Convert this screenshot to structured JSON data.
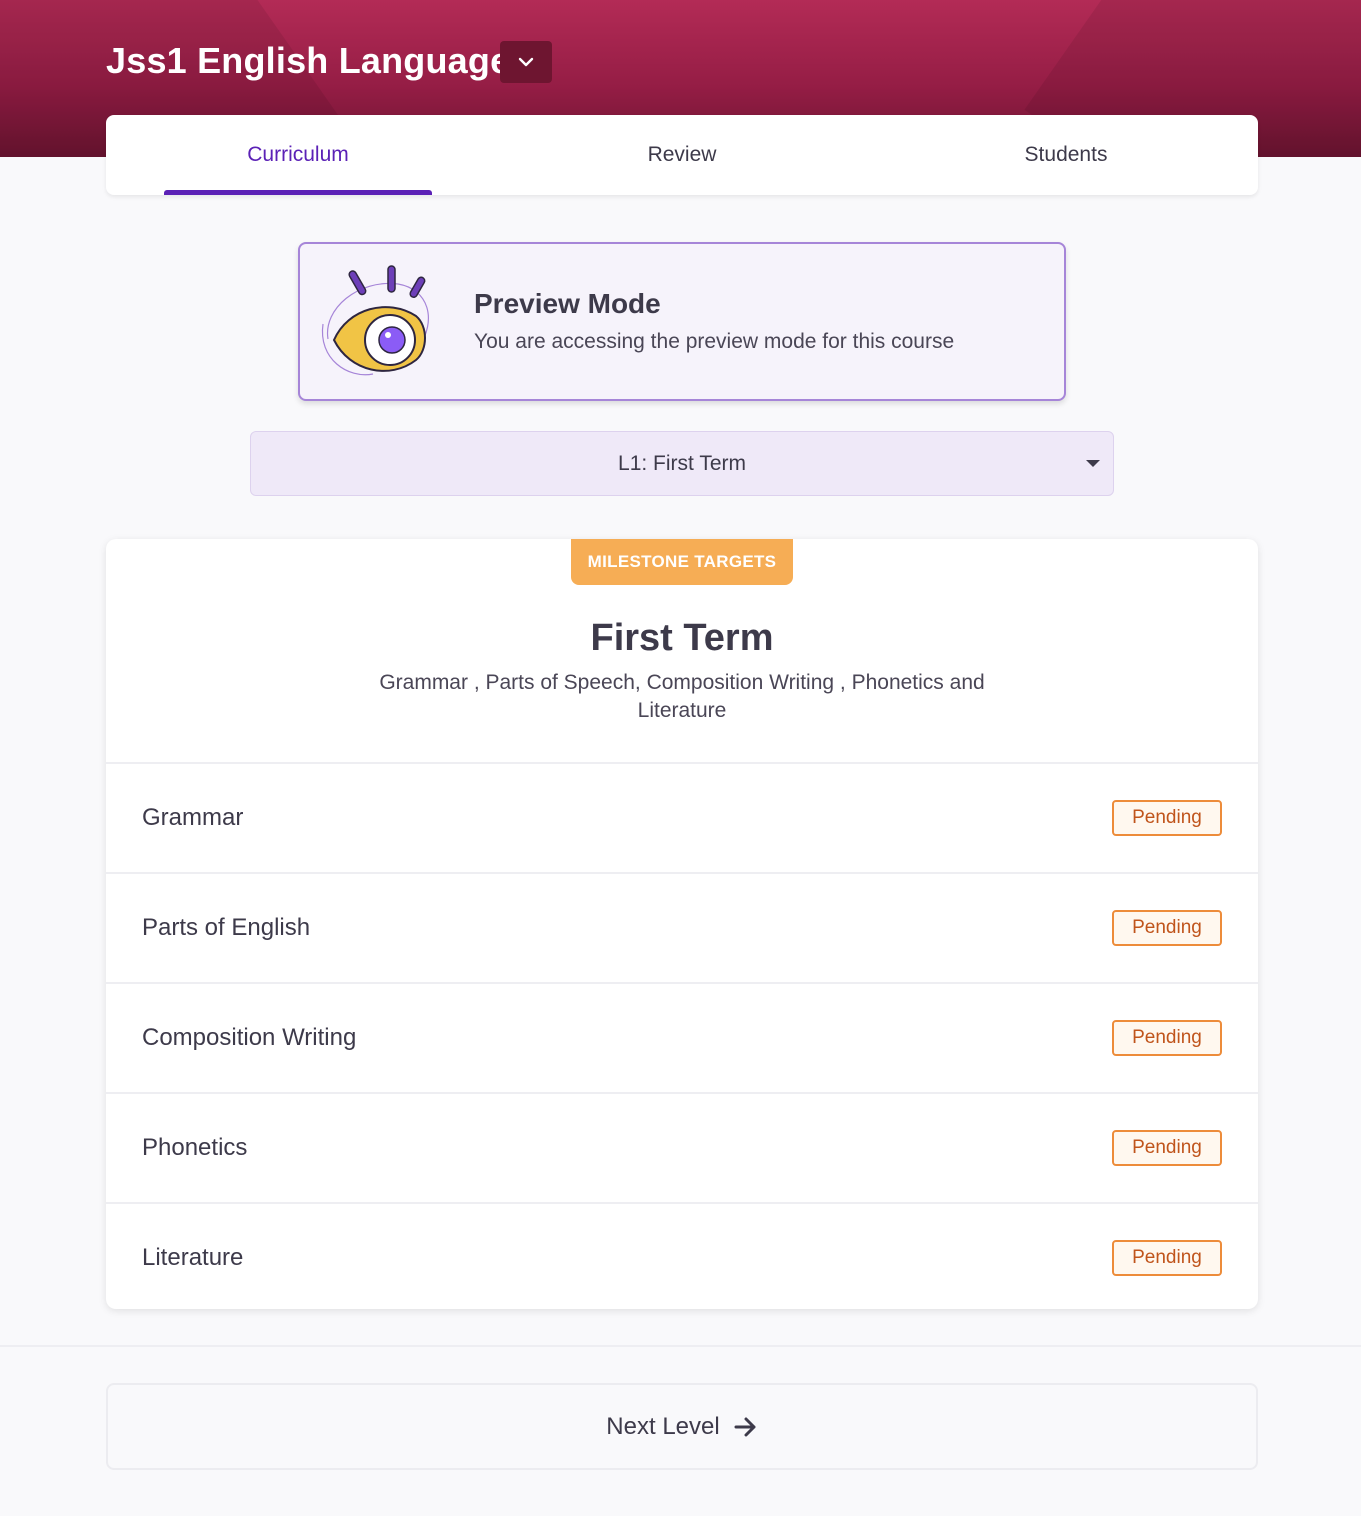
{
  "header": {
    "course_title": "Jss1 English Language"
  },
  "tabs": [
    {
      "label": "Curriculum",
      "active": true
    },
    {
      "label": "Review",
      "active": false
    },
    {
      "label": "Students",
      "active": false
    }
  ],
  "preview": {
    "title": "Preview Mode",
    "text": "You are accessing the preview mode for this course"
  },
  "level_select": {
    "selected": "L1: First Term"
  },
  "milestone": {
    "badge": "MILESTONE TARGETS",
    "title": "First Term",
    "description": "Grammar , Parts of Speech, Composition Writing , Phonetics and Literature",
    "targets": [
      {
        "name": "Grammar",
        "status": "Pending"
      },
      {
        "name": "Parts of English",
        "status": "Pending"
      },
      {
        "name": "Composition Writing",
        "status": "Pending"
      },
      {
        "name": "Phonetics",
        "status": "Pending"
      },
      {
        "name": "Literature",
        "status": "Pending"
      }
    ]
  },
  "footer": {
    "next_label": "Next Level"
  },
  "colors": {
    "brand": "#9b2048",
    "accent": "#5b21b6",
    "milestone": "#f6ad55",
    "pending": "#ed8c3a"
  }
}
